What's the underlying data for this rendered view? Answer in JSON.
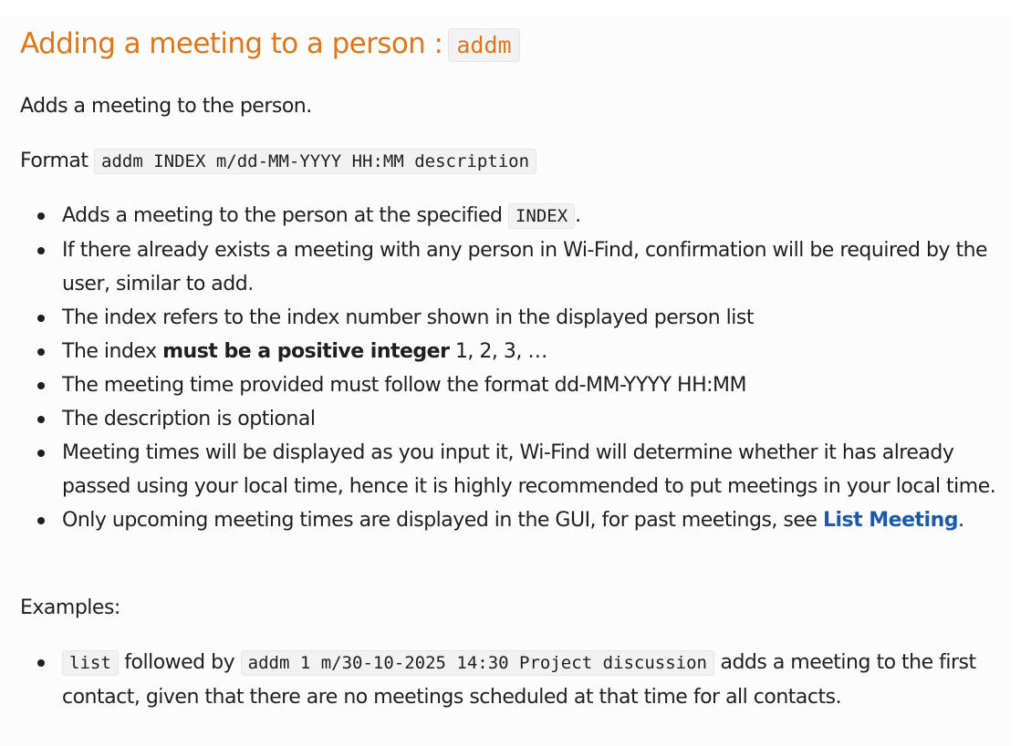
{
  "heading": {
    "text": "Adding a meeting to a person :",
    "code": "addm"
  },
  "intro": "Adds a meeting to the person.",
  "format": {
    "label": "Format",
    "code": "addm INDEX m/dd-MM-YYYY HH:MM description"
  },
  "bullets": {
    "b1_text": "Adds a meeting to the person at the specified",
    "b1_code": "INDEX",
    "b1_end": ".",
    "b2": "If there already exists a meeting with any person in Wi-Find, confirmation will be required by the user, similar to add.",
    "b3": "The index refers to the index number shown in the displayed person list",
    "b4_pre": "The index",
    "b4_bold": "must be a positive integer",
    "b4_post": "1, 2, 3, …",
    "b5": "The meeting time provided must follow the format dd-MM-YYYY HH:MM",
    "b6": "The description is optional",
    "b7": "Meeting times will be displayed as you input it, Wi-Find will determine whether it has already passed using your local time, hence it is highly recommended to put meetings in your local time.",
    "b8_pre": "Only upcoming meeting times are displayed in the GUI, for past meetings, see",
    "b8_link": "List Meeting",
    "b8_end": "."
  },
  "examples": {
    "label": "Examples:",
    "e1_code1": "list",
    "e1_mid": "followed by",
    "e1_code2": "addm 1 m/30-10-2025 14:30 Project discussion",
    "e1_post": "adds a meeting to the first contact, given that there are no meetings scheduled at that time for all contacts."
  },
  "colors": {
    "heading": "#e0761a",
    "link": "#1d5aa6",
    "code_bg": "#f2f2f2"
  }
}
